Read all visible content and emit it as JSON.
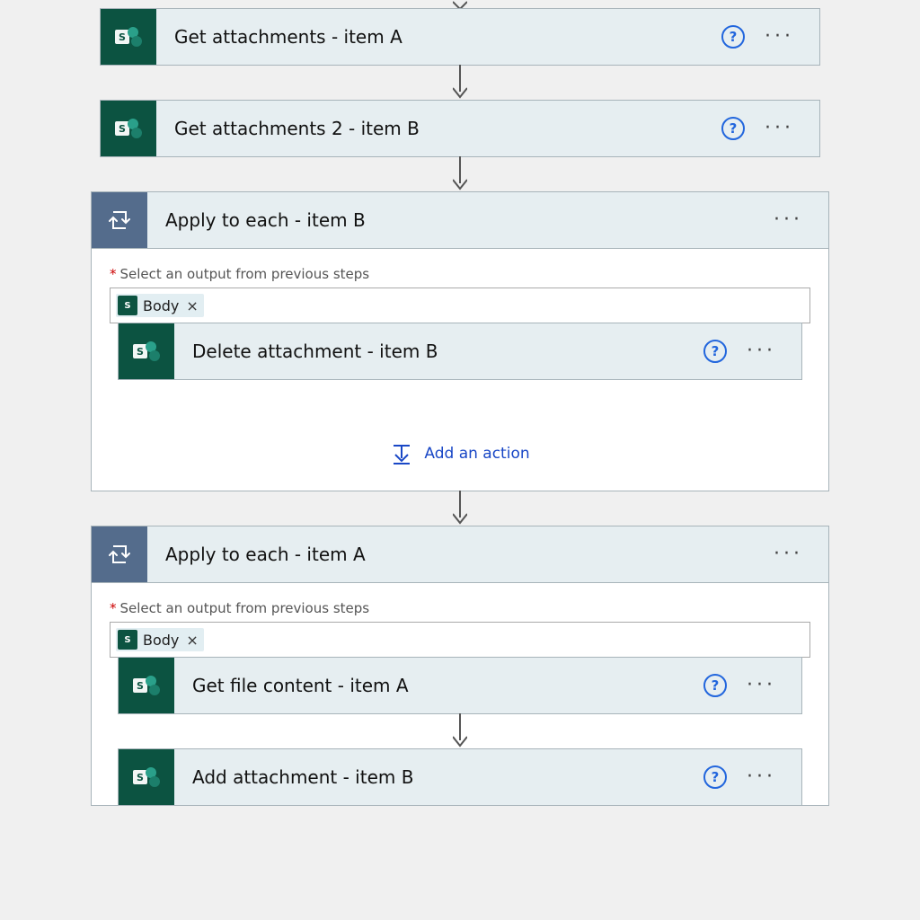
{
  "colors": {
    "sharepoint": "#0c5341",
    "loop": "#546c8c",
    "link": "#1947c6"
  },
  "steps": {
    "getAttachmentsA": "Get attachments - item A",
    "getAttachmentsB": "Get attachments 2 - item B",
    "loopB": {
      "title": "Apply to each - item B",
      "selectLabel": "Select an output from previous steps",
      "token": "Body",
      "inner": {
        "deleteAttachment": "Delete attachment - item B"
      },
      "addAction": "Add an action"
    },
    "loopA": {
      "title": "Apply to each - item A",
      "selectLabel": "Select an output from previous steps",
      "token": "Body",
      "inner": {
        "getFileContent": "Get file content - item A",
        "addAttachment": "Add attachment - item B"
      }
    }
  },
  "iconNames": {
    "sharepoint": "sharepoint-icon",
    "loop": "loop-icon",
    "help": "help-icon",
    "more": "ellipsis-icon",
    "arrow": "flow-arrow-icon",
    "addAction": "add-action-icon",
    "remove": "remove-token-icon"
  }
}
